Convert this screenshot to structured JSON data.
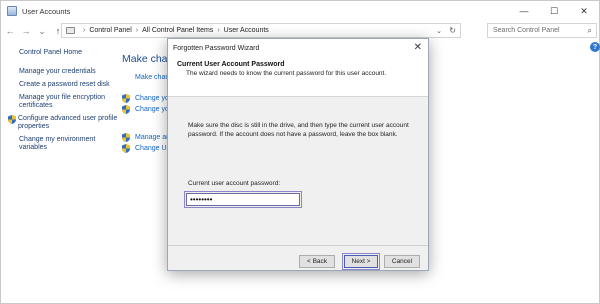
{
  "window": {
    "title": "User Accounts",
    "controls": {
      "minimize": "—",
      "maximize": "☐",
      "close": "✕"
    }
  },
  "nav": {
    "back_glyph": "←",
    "forward_glyph": "→",
    "dropdown_glyph": "⌄",
    "up_glyph": "↑"
  },
  "address": {
    "crumbs": [
      "Control Panel",
      "All Control Panel Items",
      "User Accounts"
    ],
    "separator": "›",
    "dropdown_glyph": "⌄",
    "refresh_glyph": "↻"
  },
  "search": {
    "placeholder": "Search Control Panel",
    "icon_glyph": "⌕"
  },
  "help_glyph": "?",
  "left_pane": {
    "home": "Control Panel Home",
    "items": [
      "Manage your credentials",
      "Create a password reset disk",
      "Manage your file encryption certificates",
      "Configure advanced user profile properties",
      "Change my environment variables"
    ]
  },
  "main": {
    "heading": "Make chang",
    "link0": "Make chan",
    "links": [
      "Change yo",
      "Change yo",
      "Manage an",
      "Change Us"
    ]
  },
  "dialog": {
    "title": "Forgotten Password Wizard",
    "close_glyph": "✕",
    "header_title": "Current User Account Password",
    "header_subtitle": "The wizard needs to know the current password for this user account.",
    "body": "Make sure the disc is still in the drive, and then type the current user account password. If the account does not have a password, leave the box blank.",
    "password_label": "Current user account password:",
    "password_value": "••••••••",
    "buttons": {
      "back": "< Back",
      "next": "Next >",
      "cancel": "Cancel"
    }
  },
  "colors": {
    "link": "#1565c0",
    "heading": "#1f4e99",
    "focus_ring": "#8b84c8",
    "dialog_bg": "#f0f0f0"
  }
}
